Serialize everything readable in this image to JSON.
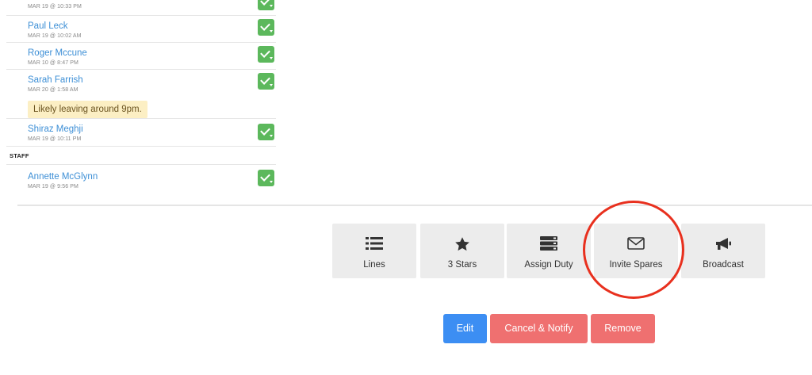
{
  "roster": {
    "items": [
      {
        "name": "",
        "time": "MAR 19 @ 10:33 PM"
      },
      {
        "name": "Paul Leck",
        "time": "MAR 19 @ 10:02 AM"
      },
      {
        "name": "Roger Mccune",
        "time": "MAR 10 @ 8:47 PM"
      },
      {
        "name": "Sarah Farrish",
        "time": "MAR 20 @ 1:58 AM",
        "note": "Likely leaving around 9pm."
      },
      {
        "name": "Shiraz Meghji",
        "time": "MAR 19 @ 10:11 PM"
      }
    ],
    "staff_header": "STAFF",
    "staff": [
      {
        "name": "Annette McGlynn",
        "time": "MAR 19 @ 9:56 PM"
      }
    ]
  },
  "toolbar": {
    "lines": "Lines",
    "stars": "3 Stars",
    "assign_duty": "Assign Duty",
    "invite_spares": "Invite Spares",
    "broadcast": "Broadcast"
  },
  "actions": {
    "edit": "Edit",
    "cancel_notify": "Cancel & Notify",
    "remove": "Remove"
  },
  "colors": {
    "link": "#3d8fd6",
    "check": "#5cb85c",
    "edit": "#3c8ef3",
    "danger": "#ef7070",
    "highlight_ring": "#e8301e"
  }
}
